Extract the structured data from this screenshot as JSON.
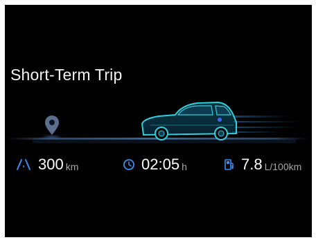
{
  "screen": {
    "title": "Short-Term Trip"
  },
  "stats": {
    "distance": {
      "value": "300",
      "unit": "km",
      "icon": "road-icon"
    },
    "time": {
      "value": "02:05",
      "unit": "h",
      "icon": "clock-icon"
    },
    "fuel": {
      "value": "7.8",
      "unit": "L/100km",
      "icon": "fuel-pump-icon"
    }
  },
  "colors": {
    "background": "#000000",
    "accent": "#3a8ef0",
    "car_glow": "#23c4d4",
    "unit_text": "#a8a8a8"
  }
}
